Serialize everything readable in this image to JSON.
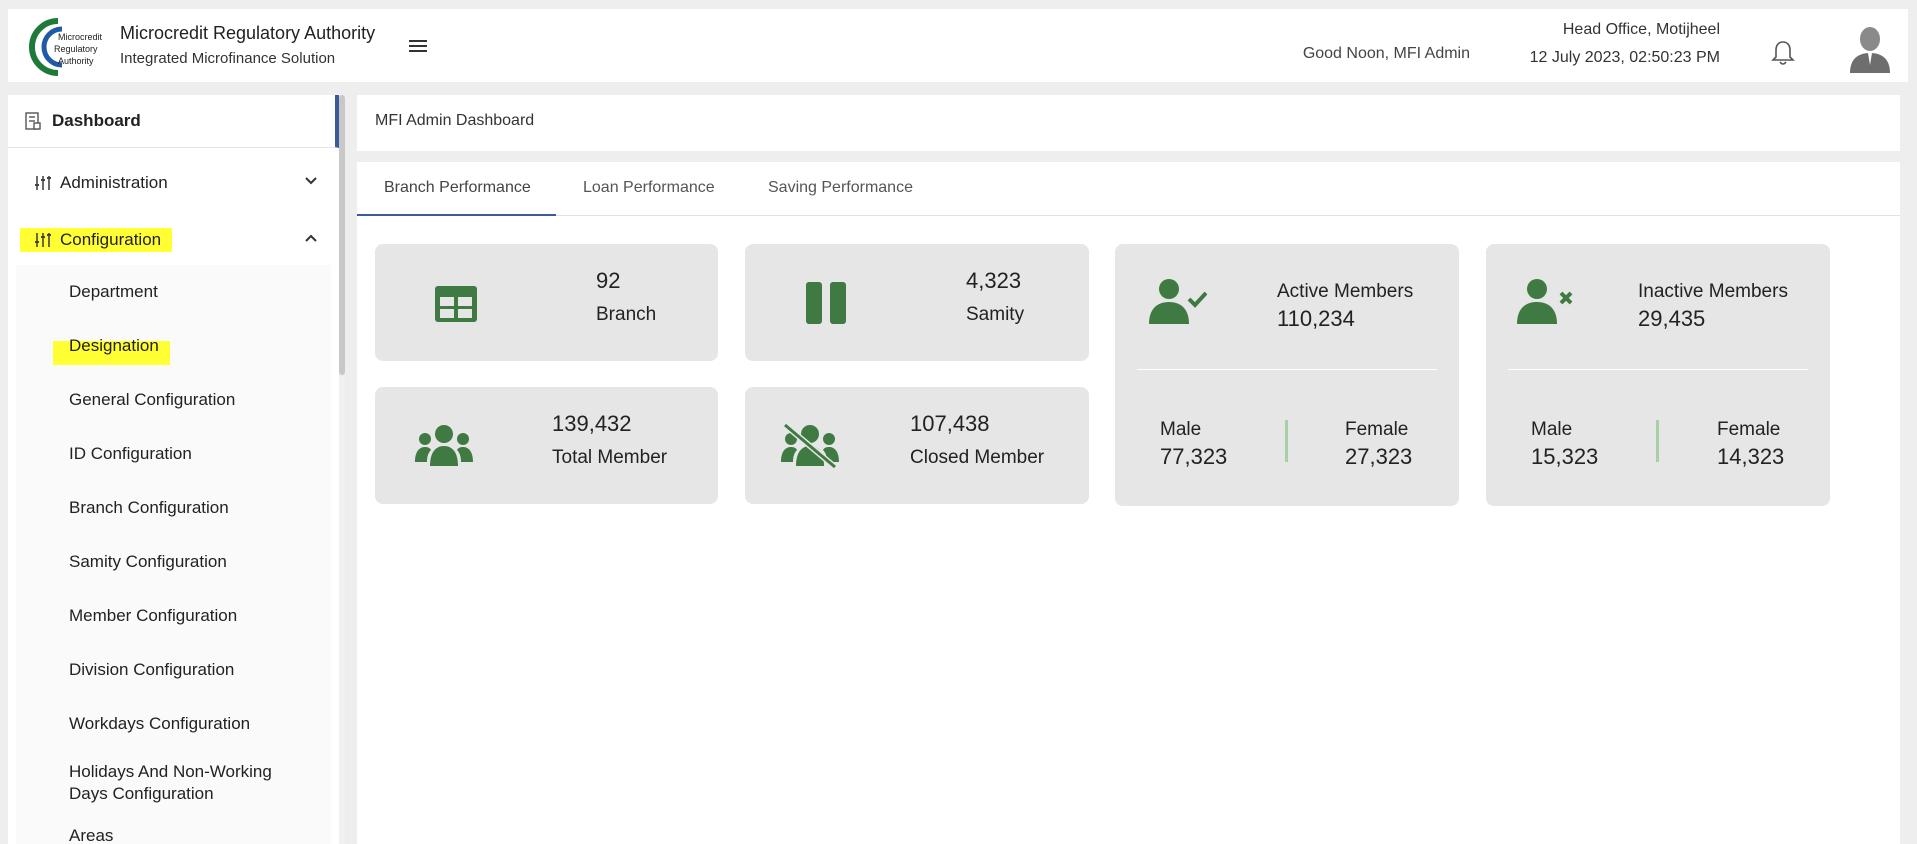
{
  "header": {
    "title": "Microcredit Regulatory Authority",
    "subtitle": "Integrated Microfinance Solution",
    "logo_text": "Microcredit Regulatory Authority",
    "greeting": "Good Noon, MFI Admin",
    "office": "Head Office, Motijheel",
    "datetime": "12 July 2023, 02:50:23 PM",
    "icons": [
      "menu-icon",
      "bell-icon",
      "user-avatar-icon"
    ]
  },
  "sidebar": {
    "dashboard": "Dashboard",
    "groups": [
      {
        "label": "Administration",
        "expanded": false
      },
      {
        "label": "Configuration",
        "expanded": true
      }
    ],
    "config_items": [
      "Department",
      "Designation",
      "General Configuration",
      "ID Configuration",
      "Branch Configuration",
      "Samity Configuration",
      "Member Configuration",
      "Division Configuration",
      "Workdays Configuration",
      "Holidays And Non-Working Days Configuration",
      "Areas"
    ],
    "highlight_color": "#ffff33"
  },
  "main": {
    "breadcrumb": "MFI Admin Dashboard",
    "tabs": [
      "Branch Performance",
      "Loan Performance",
      "Saving Performance"
    ],
    "active_tab": "Branch Performance",
    "cards": {
      "branch": {
        "value": "92",
        "label": "Branch"
      },
      "samity": {
        "value": "4,323",
        "label": "Samity"
      },
      "total_member": {
        "value": "139,432",
        "label": "Total Member"
      },
      "closed_member": {
        "value": "107,438",
        "label": "Closed Member"
      },
      "active": {
        "title": "Active Members",
        "value": "110,234",
        "male_label": "Male",
        "male": "77,323",
        "female_label": "Female",
        "female": "27,323"
      },
      "inactive": {
        "title": "Inactive Members",
        "value": "29,435",
        "male_label": "Male",
        "male": "15,323",
        "female_label": "Female",
        "female": "14,323"
      }
    }
  },
  "colors": {
    "accent": "#3a5a9a",
    "icon_green": "#3e7a42",
    "card_bg": "#e5e6e5"
  }
}
